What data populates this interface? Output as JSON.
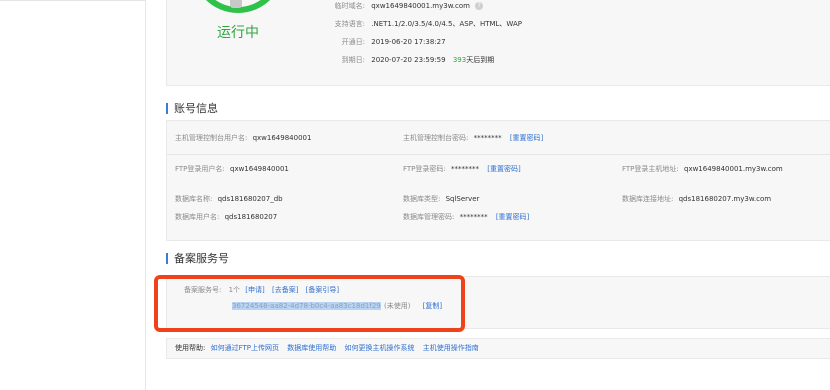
{
  "status": {
    "running_label": "运行中",
    "info": [
      {
        "label": "临时域名:",
        "value": "qxw1649840001.my3w.com"
      },
      {
        "label": "支持语言:",
        "value": ".NET1.1/2.0/3.5/4.0/4.5、ASP、HTML、WAP"
      },
      {
        "label": "开通日:",
        "value": "2019-06-20 17:38:27"
      },
      {
        "label": "到期日:",
        "value": "2020-07-20 23:59:59",
        "days": "393",
        "days_suffix": "天后到期"
      }
    ],
    "help_icon_glyph": "?"
  },
  "account": {
    "title": "账号信息",
    "host_user_label": "主机管理控制台用户名:",
    "host_user_value": "qxw1649840001",
    "host_pwd_label": "主机管理控制台密码:",
    "host_pwd_value": "********",
    "host_pwd_reset": "[重置密码]",
    "ftp_user_label": "FTP登录用户名:",
    "ftp_user_value": "qxw1649840001",
    "ftp_pwd_label": "FTP登录密码:",
    "ftp_pwd_value": "********",
    "ftp_pwd_reset": "[重置密码]",
    "ftp_host_label": "FTP登录主机地址:",
    "ftp_host_value": "qxw1649840001.my3w.com",
    "db_name_label": "数据库名称:",
    "db_name_value": "qds181680207_db",
    "db_type_label": "数据库类型:",
    "db_type_value": "SqlServer",
    "db_addr_label": "数据库连接地址:",
    "db_addr_value": "qds181680207.my3w.com",
    "db_user_label": "数据库用户名:",
    "db_user_value": "qds181680207",
    "db_pwd_label": "数据库管理密码:",
    "db_pwd_value": "********",
    "db_pwd_reset": "[重置密码]"
  },
  "filing": {
    "title": "备案服务号",
    "label": "备案服务号:",
    "count": "1个",
    "apply": "[申请]",
    "go_filing": "[去备案]",
    "guide": "[备案引导]",
    "service_code": "36724548-aa82-4d78-b0c4-aa83c18d1f29",
    "unused": "(未使用)",
    "copy": "[复制]"
  },
  "help": {
    "label": "使用帮助:",
    "links": [
      "如何通过FTP上传网页",
      "数据库使用帮助",
      "如何更换主机操作系统",
      "主机使用操作指南"
    ]
  },
  "colors": {
    "accent_green": "#2fc24a",
    "link_blue": "#2e6fd1",
    "highlight_red": "#f0421a"
  }
}
